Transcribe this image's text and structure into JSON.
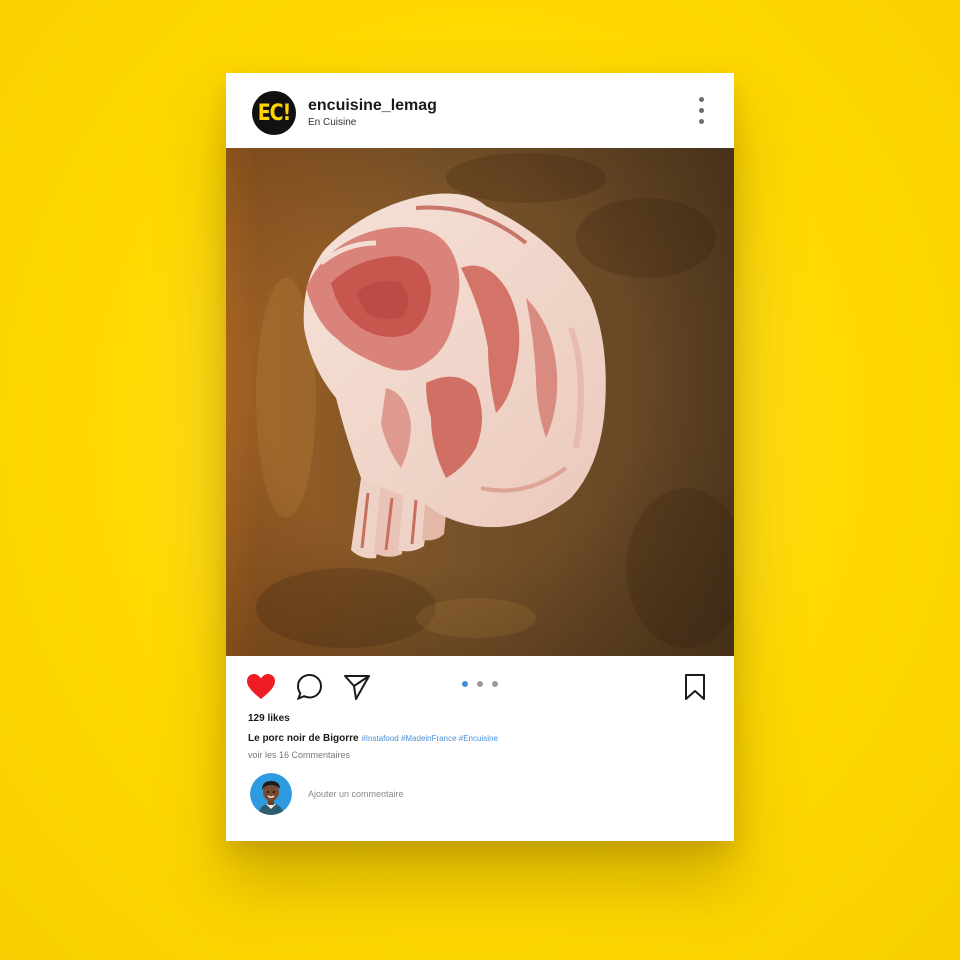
{
  "post": {
    "account": {
      "username": "encuisine_lemag",
      "display_name": "En Cuisine",
      "logo_text": "EC!"
    },
    "photo": {
      "subject": "watercolor illustration of a pork rib chop",
      "carousel_pages": 3,
      "active_page": 1
    },
    "actions": {
      "liked": true,
      "like_icon": "heart-icon",
      "comment_icon": "comment-bubble-icon",
      "share_icon": "paper-plane-icon",
      "save_icon": "bookmark-icon"
    },
    "likes_label": "129 likes",
    "caption": {
      "title": "Le porc noir de Bigorre",
      "hashtags": "#Instafood #MadeinFrance #Encuisine"
    },
    "view_comments_label": "voir les 16 Commentaires",
    "add_comment_placeholder": "Ajouter un commentaire"
  },
  "colors": {
    "background": "#FFD900",
    "like_red": "#EE1C25",
    "hashtag_blue": "#4A90D9",
    "active_dot": "#3D8FD8",
    "logo_yellow": "#FFD400"
  }
}
